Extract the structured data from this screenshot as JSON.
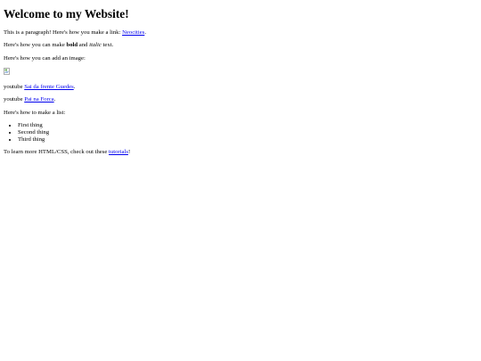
{
  "page": {
    "heading": "Welcome to my Website!",
    "intro": {
      "text_before_link": "This is a paragraph! Here's how you make a link: ",
      "link_text": "Neocities",
      "text_after_link": "."
    },
    "formatting": {
      "text_before_bold": "Here's how you can make ",
      "bold_text": "bold",
      "text_between": " and ",
      "italic_text": "italic",
      "text_after": " text."
    },
    "image_paragraph": "Here's how you can add an image:",
    "youtube_links": [
      {
        "prefix": "youtube ",
        "link_text": "Sai da frente Guedes",
        "suffix": "."
      },
      {
        "prefix": "youtube ",
        "link_text": "Pai na Forca",
        "suffix": "."
      }
    ],
    "list_intro": "Here's how to make a list:",
    "list_items": [
      "First thing",
      "Second thing",
      "Third thing"
    ],
    "outro": {
      "text_before_link": "To learn more HTML/CSS, check out these ",
      "link_text": "tutorials",
      "text_after_link": "!"
    }
  },
  "icons": {
    "broken_image": "broken-image-icon"
  }
}
